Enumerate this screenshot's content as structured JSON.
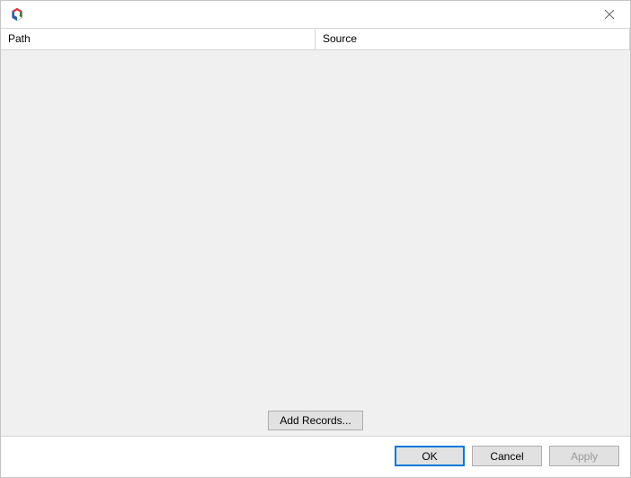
{
  "titlebar": {
    "title": ""
  },
  "table": {
    "columns": {
      "path": "Path",
      "source": "Source"
    },
    "rows": []
  },
  "actions": {
    "add_records": "Add Records..."
  },
  "buttons": {
    "ok": "OK",
    "cancel": "Cancel",
    "apply": "Apply"
  }
}
